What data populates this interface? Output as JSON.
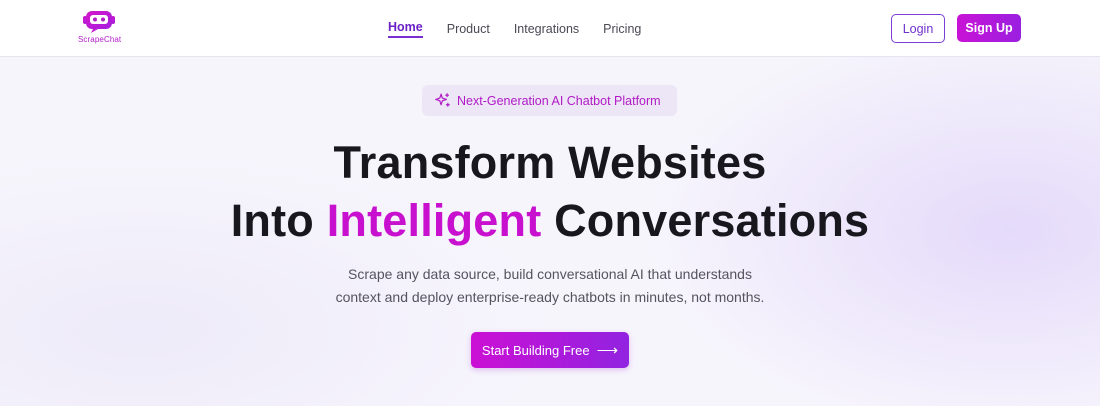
{
  "brand": {
    "name": "ScrapeChat",
    "logo_icon": "robot-chat-icon",
    "accent_color": "#c810cf",
    "primary_gradient": [
      "#cb10d4",
      "#9123e0"
    ]
  },
  "nav": {
    "items": [
      {
        "label": "Home",
        "active": true
      },
      {
        "label": "Product",
        "active": false
      },
      {
        "label": "Integrations",
        "active": false
      },
      {
        "label": "Pricing",
        "active": false
      }
    ]
  },
  "auth": {
    "login_label": "Login",
    "signup_label": "Sign Up"
  },
  "hero": {
    "badge_icon": "sparkles-icon",
    "badge_text": "Next-Generation AI Chatbot Platform",
    "headline_line1": "Transform Websites",
    "headline_line2_prefix": "Into ",
    "headline_line2_accent": "Intelligent",
    "headline_line2_suffix": " Conversations",
    "subtext_line1": "Scrape any data source, build conversational AI that understands",
    "subtext_line2": "context and deploy enterprise-ready chatbots in minutes, not months.",
    "cta_label": "Start Building Free",
    "cta_icon": "arrow-right-icon",
    "cta_arrow_glyph": "⟶"
  }
}
